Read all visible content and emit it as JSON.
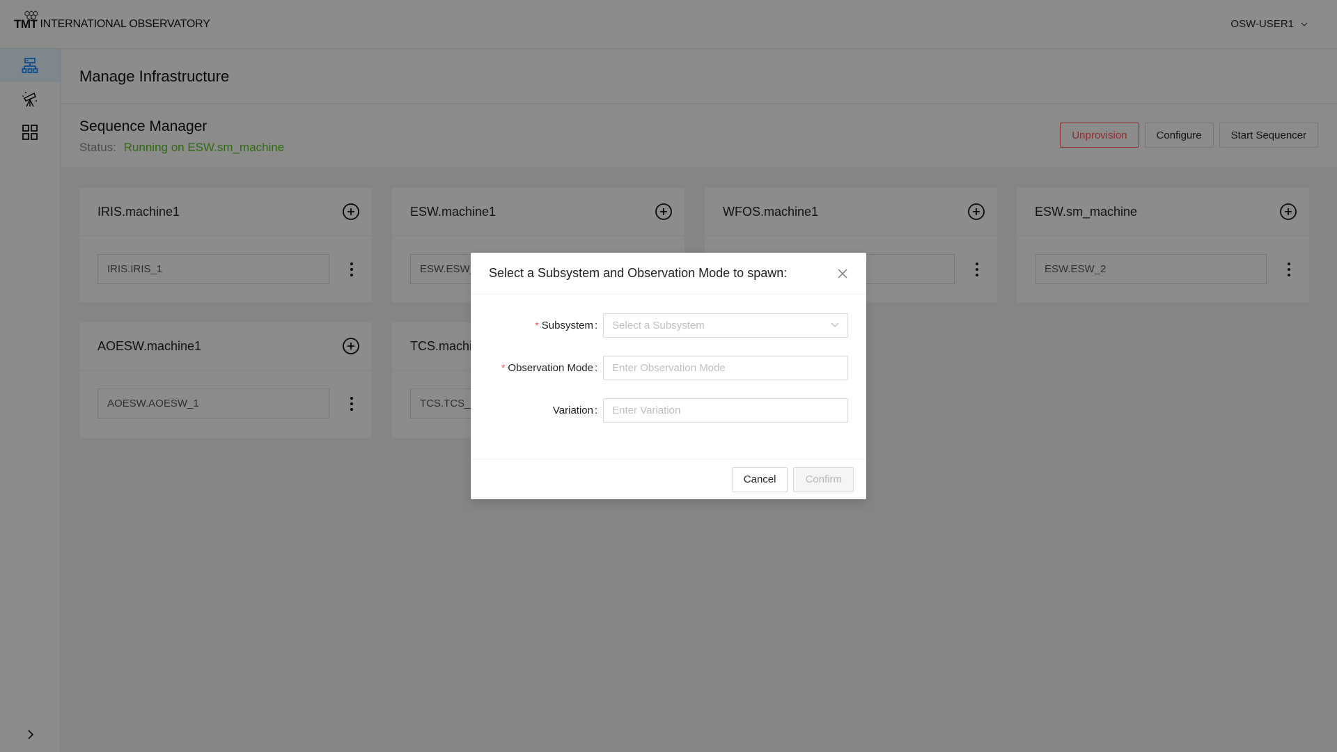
{
  "header": {
    "logo_bold": "TMT",
    "logo_text": "INTERNATIONAL OBSERVATORY",
    "user": "OSW-USER1"
  },
  "sidebar": {
    "items": [
      {
        "icon": "infrastructure-icon",
        "active": true
      },
      {
        "icon": "telescope-icon",
        "active": false
      },
      {
        "icon": "grid-icon",
        "active": false
      }
    ],
    "collapse_icon": "chevron-right-icon"
  },
  "page": {
    "title": "Manage Infrastructure"
  },
  "sequence_manager": {
    "title": "Sequence Manager",
    "status_label": "Status:",
    "status_value": "Running on ESW.sm_machine",
    "status_color": "#52c41a",
    "actions": {
      "unprovision": "Unprovision",
      "configure": "Configure",
      "start_sequencer": "Start Sequencer"
    }
  },
  "machines": [
    {
      "name": "IRIS.machine1",
      "sequencer": "IRIS.IRIS_1"
    },
    {
      "name": "ESW.machine1",
      "sequencer": "ESW.ESW_1"
    },
    {
      "name": "WFOS.machine1",
      "sequencer": ""
    },
    {
      "name": "ESW.sm_machine",
      "sequencer": "ESW.ESW_2"
    },
    {
      "name": "AOESW.machine1",
      "sequencer": "AOESW.AOESW_1"
    },
    {
      "name": "TCS.machine1",
      "sequencer": "TCS.TCS_1"
    }
  ],
  "modal": {
    "title": "Select a Subsystem and Observation Mode to spawn:",
    "fields": {
      "subsystem": {
        "label": "Subsystem",
        "placeholder": "Select a Subsystem",
        "required": true
      },
      "observation_mode": {
        "label": "Observation Mode",
        "placeholder": "Enter Observation Mode",
        "required": true
      },
      "variation": {
        "label": "Variation",
        "placeholder": "Enter Variation",
        "required": false
      }
    },
    "colon": ":",
    "required_mark": "*",
    "cancel": "Cancel",
    "confirm": "Confirm"
  }
}
